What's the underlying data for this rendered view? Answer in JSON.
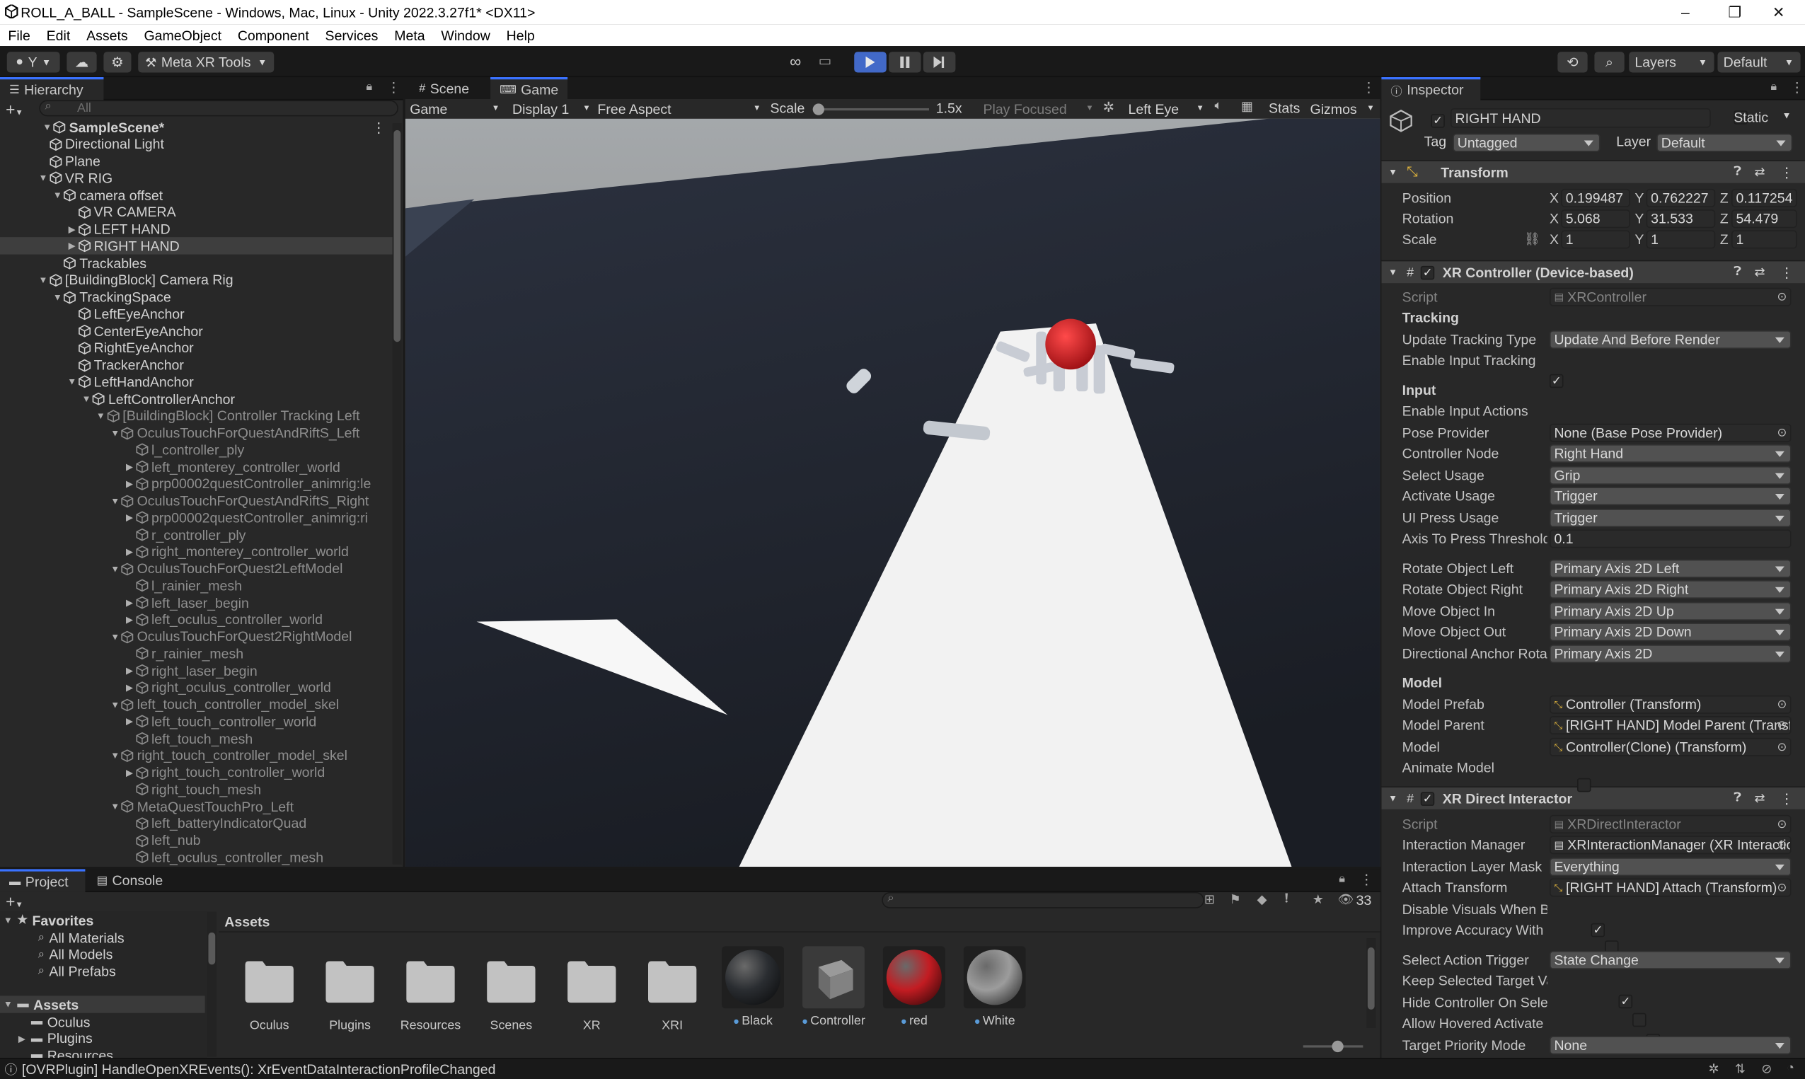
{
  "window": {
    "title": "ROLL_A_BALL - SampleScene - Windows, Mac, Linux - Unity 2022.3.27f1* <DX11>"
  },
  "menu": [
    "File",
    "Edit",
    "Assets",
    "GameObject",
    "Component",
    "Services",
    "Meta",
    "Window",
    "Help"
  ],
  "toolbar": {
    "account_label": "Y",
    "meta_tools_label": "Meta XR Tools",
    "layers_label": "Layers",
    "layout_label": "Default"
  },
  "hierarchy": {
    "tab": "Hierarchy",
    "search_placeholder": "All",
    "items": [
      {
        "label": "SampleScene*",
        "depth": 0,
        "fold": "down",
        "kind": "scene",
        "bold": true
      },
      {
        "label": "Directional Light",
        "depth": 1,
        "fold": "",
        "kind": "cube"
      },
      {
        "label": "Plane",
        "depth": 1,
        "fold": "",
        "kind": "cube"
      },
      {
        "label": "VR RIG",
        "depth": 1,
        "fold": "down",
        "kind": "cube"
      },
      {
        "label": "camera offset",
        "depth": 2,
        "fold": "down",
        "kind": "cube"
      },
      {
        "label": "VR CAMERA",
        "depth": 3,
        "fold": "",
        "kind": "cube"
      },
      {
        "label": "LEFT HAND",
        "depth": 3,
        "fold": "right",
        "kind": "cube"
      },
      {
        "label": "RIGHT HAND",
        "depth": 3,
        "fold": "right",
        "kind": "cube",
        "selected": true
      },
      {
        "label": "Trackables",
        "depth": 2,
        "fold": "",
        "kind": "cube"
      },
      {
        "label": "[BuildingBlock] Camera Rig",
        "depth": 1,
        "fold": "down",
        "kind": "cube"
      },
      {
        "label": "TrackingSpace",
        "depth": 2,
        "fold": "down",
        "kind": "cube"
      },
      {
        "label": "LeftEyeAnchor",
        "depth": 3,
        "fold": "",
        "kind": "cube"
      },
      {
        "label": "CenterEyeAnchor",
        "depth": 3,
        "fold": "",
        "kind": "cube"
      },
      {
        "label": "RightEyeAnchor",
        "depth": 3,
        "fold": "",
        "kind": "cube"
      },
      {
        "label": "TrackerAnchor",
        "depth": 3,
        "fold": "",
        "kind": "cube"
      },
      {
        "label": "LeftHandAnchor",
        "depth": 3,
        "fold": "down",
        "kind": "cube"
      },
      {
        "label": "LeftControllerAnchor",
        "depth": 4,
        "fold": "down",
        "kind": "cube"
      },
      {
        "label": "[BuildingBlock] Controller Tracking Left",
        "depth": 5,
        "fold": "down",
        "kind": "cube",
        "dim": true
      },
      {
        "label": "OculusTouchForQuestAndRiftS_Left",
        "depth": 6,
        "fold": "down",
        "kind": "cube",
        "dim": true
      },
      {
        "label": "l_controller_ply",
        "depth": 7,
        "fold": "",
        "kind": "cube",
        "dim": true
      },
      {
        "label": "left_monterey_controller_world",
        "depth": 7,
        "fold": "right",
        "kind": "cube",
        "dim": true
      },
      {
        "label": "prp00002questController_animrig:le",
        "depth": 7,
        "fold": "right",
        "kind": "cube",
        "dim": true
      },
      {
        "label": "OculusTouchForQuestAndRiftS_Right",
        "depth": 6,
        "fold": "down",
        "kind": "cube",
        "dim": true
      },
      {
        "label": "prp00002questController_animrig:ri",
        "depth": 7,
        "fold": "right",
        "kind": "cube",
        "dim": true
      },
      {
        "label": "r_controller_ply",
        "depth": 7,
        "fold": "",
        "kind": "cube",
        "dim": true
      },
      {
        "label": "right_monterey_controller_world",
        "depth": 7,
        "fold": "right",
        "kind": "cube",
        "dim": true
      },
      {
        "label": "OculusTouchForQuest2LeftModel",
        "depth": 6,
        "fold": "down",
        "kind": "cube",
        "dim": true
      },
      {
        "label": "l_rainier_mesh",
        "depth": 7,
        "fold": "",
        "kind": "cube",
        "dim": true
      },
      {
        "label": "left_laser_begin",
        "depth": 7,
        "fold": "right",
        "kind": "cube",
        "dim": true
      },
      {
        "label": "left_oculus_controller_world",
        "depth": 7,
        "fold": "right",
        "kind": "cube",
        "dim": true
      },
      {
        "label": "OculusTouchForQuest2RightModel",
        "depth": 6,
        "fold": "down",
        "kind": "cube",
        "dim": true
      },
      {
        "label": "r_rainier_mesh",
        "depth": 7,
        "fold": "",
        "kind": "cube",
        "dim": true
      },
      {
        "label": "right_laser_begin",
        "depth": 7,
        "fold": "right",
        "kind": "cube",
        "dim": true
      },
      {
        "label": "right_oculus_controller_world",
        "depth": 7,
        "fold": "right",
        "kind": "cube",
        "dim": true
      },
      {
        "label": "left_touch_controller_model_skel",
        "depth": 6,
        "fold": "down",
        "kind": "cube",
        "dim": true
      },
      {
        "label": "left_touch_controller_world",
        "depth": 7,
        "fold": "right",
        "kind": "cube",
        "dim": true
      },
      {
        "label": "left_touch_mesh",
        "depth": 7,
        "fold": "",
        "kind": "cube",
        "dim": true
      },
      {
        "label": "right_touch_controller_model_skel",
        "depth": 6,
        "fold": "down",
        "kind": "cube",
        "dim": true
      },
      {
        "label": "right_touch_controller_world",
        "depth": 7,
        "fold": "right",
        "kind": "cube",
        "dim": true
      },
      {
        "label": "right_touch_mesh",
        "depth": 7,
        "fold": "",
        "kind": "cube",
        "dim": true
      },
      {
        "label": "MetaQuestTouchPro_Left",
        "depth": 6,
        "fold": "down",
        "kind": "cube",
        "dim": true
      },
      {
        "label": "left_batteryIndicatorQuad",
        "depth": 7,
        "fold": "",
        "kind": "cube",
        "dim": true
      },
      {
        "label": "left_nub",
        "depth": 7,
        "fold": "",
        "kind": "cube",
        "dim": true
      },
      {
        "label": "left_oculus_controller_mesh",
        "depth": 7,
        "fold": "",
        "kind": "cube",
        "dim": true
      }
    ]
  },
  "center": {
    "tabs": [
      "Scene",
      "Game"
    ],
    "game_toolbar": {
      "mode": "Game",
      "display": "Display 1",
      "aspect": "Free Aspect",
      "scale_label": "Scale",
      "scale_value": "1.5x",
      "play_focused": "Play Focused",
      "eye": "Left Eye",
      "stats": "Stats",
      "gizmos": "Gizmos"
    }
  },
  "inspector": {
    "tab": "Inspector",
    "object_name": "RIGHT HAND",
    "static_label": "Static",
    "tag_label": "Tag",
    "tag_value": "Untagged",
    "layer_label": "Layer",
    "layer_value": "Default",
    "transform": {
      "title": "Transform",
      "position_label": "Position",
      "rotation_label": "Rotation",
      "scale_label": "Scale",
      "position": [
        "0.199487",
        "0.762227",
        "0.117254"
      ],
      "rotation": [
        "5.068",
        "31.533",
        "54.479"
      ],
      "scale": [
        "1",
        "1",
        "1"
      ]
    },
    "xr_controller": {
      "title": "XR Controller (Device-based)",
      "script_label": "Script",
      "script_value": "XRController",
      "tracking_header": "Tracking",
      "update_tracking_type_label": "Update Tracking Type",
      "update_tracking_type_value": "Update And Before Render",
      "enable_input_tracking_label": "Enable Input Tracking",
      "input_header": "Input",
      "enable_input_actions_label": "Enable Input Actions",
      "pose_provider_label": "Pose Provider",
      "pose_provider_value": "None (Base Pose Provider)",
      "controller_node_label": "Controller Node",
      "controller_node_value": "Right Hand",
      "select_usage_label": "Select Usage",
      "select_usage_value": "Grip",
      "activate_usage_label": "Activate Usage",
      "activate_usage_value": "Trigger",
      "ui_press_usage_label": "UI Press Usage",
      "ui_press_usage_value": "Trigger",
      "axis_press_threshold_label": "Axis To Press Threshold",
      "axis_press_threshold_value": "0.1",
      "rotate_left_label": "Rotate Object Left",
      "rotate_left_value": "Primary Axis 2D Left",
      "rotate_right_label": "Rotate Object Right",
      "rotate_right_value": "Primary Axis 2D Right",
      "move_in_label": "Move Object In",
      "move_in_value": "Primary Axis 2D Up",
      "move_out_label": "Move Object Out",
      "move_out_value": "Primary Axis 2D Down",
      "dir_anchor_label": "Directional Anchor Rotation",
      "dir_anchor_value": "Primary Axis 2D",
      "model_header": "Model",
      "model_prefab_label": "Model Prefab",
      "model_prefab_value": "Controller (Transform)",
      "model_parent_label": "Model Parent",
      "model_parent_value": "[RIGHT HAND] Model Parent (Transform)",
      "model_label": "Model",
      "model_value": "Controller(Clone) (Transform)",
      "animate_model_label": "Animate Model"
    },
    "xr_direct": {
      "title": "XR Direct Interactor",
      "script_label": "Script",
      "script_value": "XRDirectInteractor",
      "interaction_manager_label": "Interaction Manager",
      "interaction_manager_value": "XRInteractionManager (XR Interaction Manager)",
      "interaction_layer_mask_label": "Interaction Layer Mask",
      "interaction_layer_mask_value": "Everything",
      "attach_transform_label": "Attach Transform",
      "attach_transform_value": "[RIGHT HAND] Attach (Transform)",
      "disable_visuals_label": "Disable Visuals When Blocked",
      "improve_accuracy_label": "Improve Accuracy With Sphere Collider",
      "select_action_trigger_label": "Select Action Trigger",
      "select_action_trigger_value": "State Change",
      "keep_selected_label": "Keep Selected Target Valid",
      "hide_controller_label": "Hide Controller On Select",
      "allow_hovered_label": "Allow Hovered Activate",
      "target_priority_label": "Target Priority Mode",
      "target_priority_value": "None"
    }
  },
  "project": {
    "tabs": [
      "Project",
      "Console"
    ],
    "hidden_count": "33",
    "favorites_label": "Favorites",
    "favorites": [
      "All Materials",
      "All Models",
      "All Prefabs"
    ],
    "assets_label": "Assets",
    "asset_tree": [
      "Oculus",
      "Plugins",
      "Resources"
    ],
    "breadcrumb": "Assets",
    "grid": [
      {
        "name": "Oculus",
        "type": "folder"
      },
      {
        "name": "Plugins",
        "type": "folder"
      },
      {
        "name": "Resources",
        "type": "folder"
      },
      {
        "name": "Scenes",
        "type": "folder"
      },
      {
        "name": "XR",
        "type": "folder"
      },
      {
        "name": "XRI",
        "type": "folder"
      },
      {
        "name": "Black",
        "type": "material",
        "color": "#2a2d31"
      },
      {
        "name": "Controller",
        "type": "prefab"
      },
      {
        "name": "red",
        "type": "material",
        "color": "#c31c22"
      },
      {
        "name": "White",
        "type": "material",
        "color": "#9c9c9c"
      }
    ]
  },
  "status": {
    "message": "[OVRPlugin] HandleOpenXREvents(): XrEventDataInteractionProfileChanged"
  },
  "colors": {
    "accent": "#3a72ff",
    "ball": "#c31c22",
    "selected_row": "#3e3e3e"
  }
}
